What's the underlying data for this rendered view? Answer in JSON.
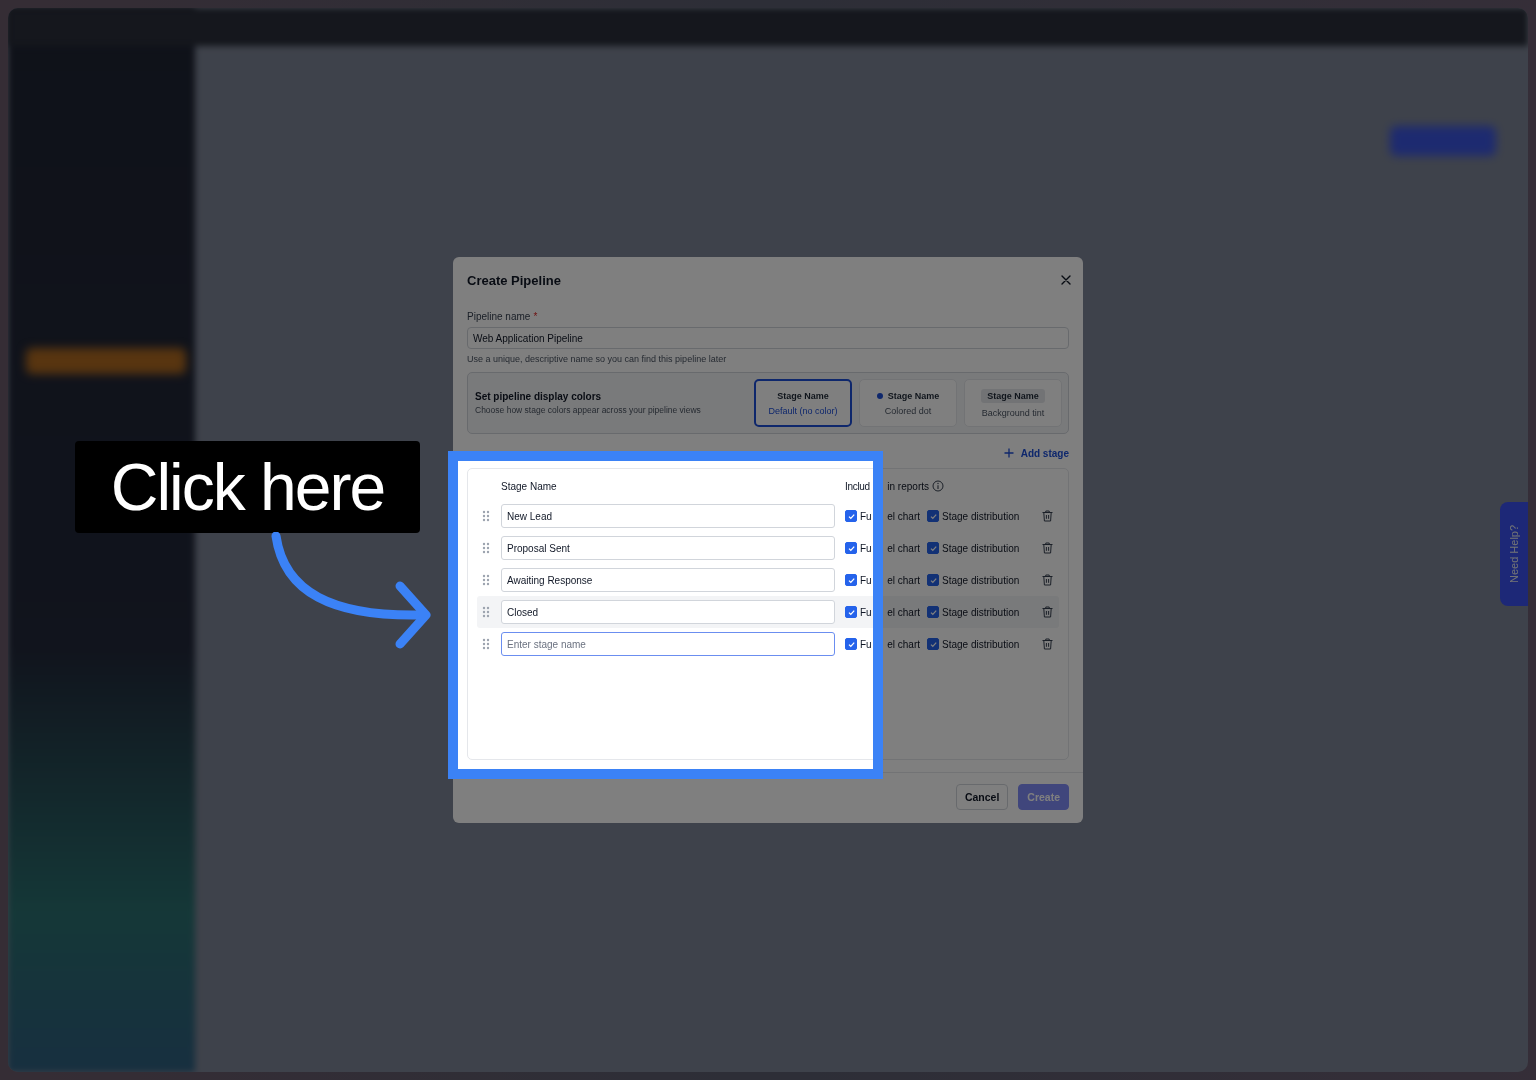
{
  "dialog": {
    "title": "Create Pipeline",
    "pipeline_name": {
      "label": "Pipeline name",
      "required_mark": "*",
      "value": "Web Application Pipeline",
      "help": "Use a unique, descriptive name so you can find this pipeline later"
    },
    "display_colors": {
      "title": "Set pipeline display colors",
      "description": "Choose how stage colors appear across your pipeline views",
      "options": [
        {
          "kind": "plain",
          "sample": "Stage Name",
          "caption": "Default (no color)",
          "selected": true
        },
        {
          "kind": "dot",
          "sample": "Stage Name",
          "caption": "Colored dot",
          "selected": false
        },
        {
          "kind": "tint",
          "sample": "Stage Name",
          "caption": "Background tint",
          "selected": false
        }
      ]
    },
    "add_stage": "Add stage",
    "columns": {
      "name": "Stage Name",
      "reports_parts": [
        "Includ",
        "in reports"
      ]
    },
    "stages": [
      {
        "value": "New Lead",
        "focused": false,
        "highlighted": false,
        "funnel_chart": {
          "label_parts": [
            "Fu",
            "el chart"
          ],
          "checked": true
        },
        "stage_distribution": {
          "label": "Stage distribution",
          "checked": true
        }
      },
      {
        "value": "Proposal Sent",
        "focused": false,
        "highlighted": false,
        "funnel_chart": {
          "label_parts": [
            "Fu",
            "el chart"
          ],
          "checked": true
        },
        "stage_distribution": {
          "label": "Stage distribution",
          "checked": true
        }
      },
      {
        "value": "Awaiting Response",
        "focused": false,
        "highlighted": false,
        "funnel_chart": {
          "label_parts": [
            "Fu",
            "el chart"
          ],
          "checked": true
        },
        "stage_distribution": {
          "label": "Stage distribution",
          "checked": true
        }
      },
      {
        "value": "Closed",
        "focused": false,
        "highlighted": true,
        "funnel_chart": {
          "label_parts": [
            "Fu",
            "el chart"
          ],
          "checked": true
        },
        "stage_distribution": {
          "label": "Stage distribution",
          "checked": true
        }
      },
      {
        "placeholder": "Enter stage name",
        "focused": true,
        "highlighted": false,
        "funnel_chart": {
          "label_parts": [
            "Fu",
            "el chart"
          ],
          "checked": true
        },
        "stage_distribution": {
          "label": "Stage distribution",
          "checked": true
        }
      }
    ],
    "buttons": [
      {
        "label": "Cancel",
        "kind": "secondary",
        "disabled": false
      },
      {
        "label": "Create",
        "kind": "primary",
        "disabled": true
      }
    ]
  },
  "help_tab": "Need Help?",
  "callout": {
    "text": "Click here"
  }
}
